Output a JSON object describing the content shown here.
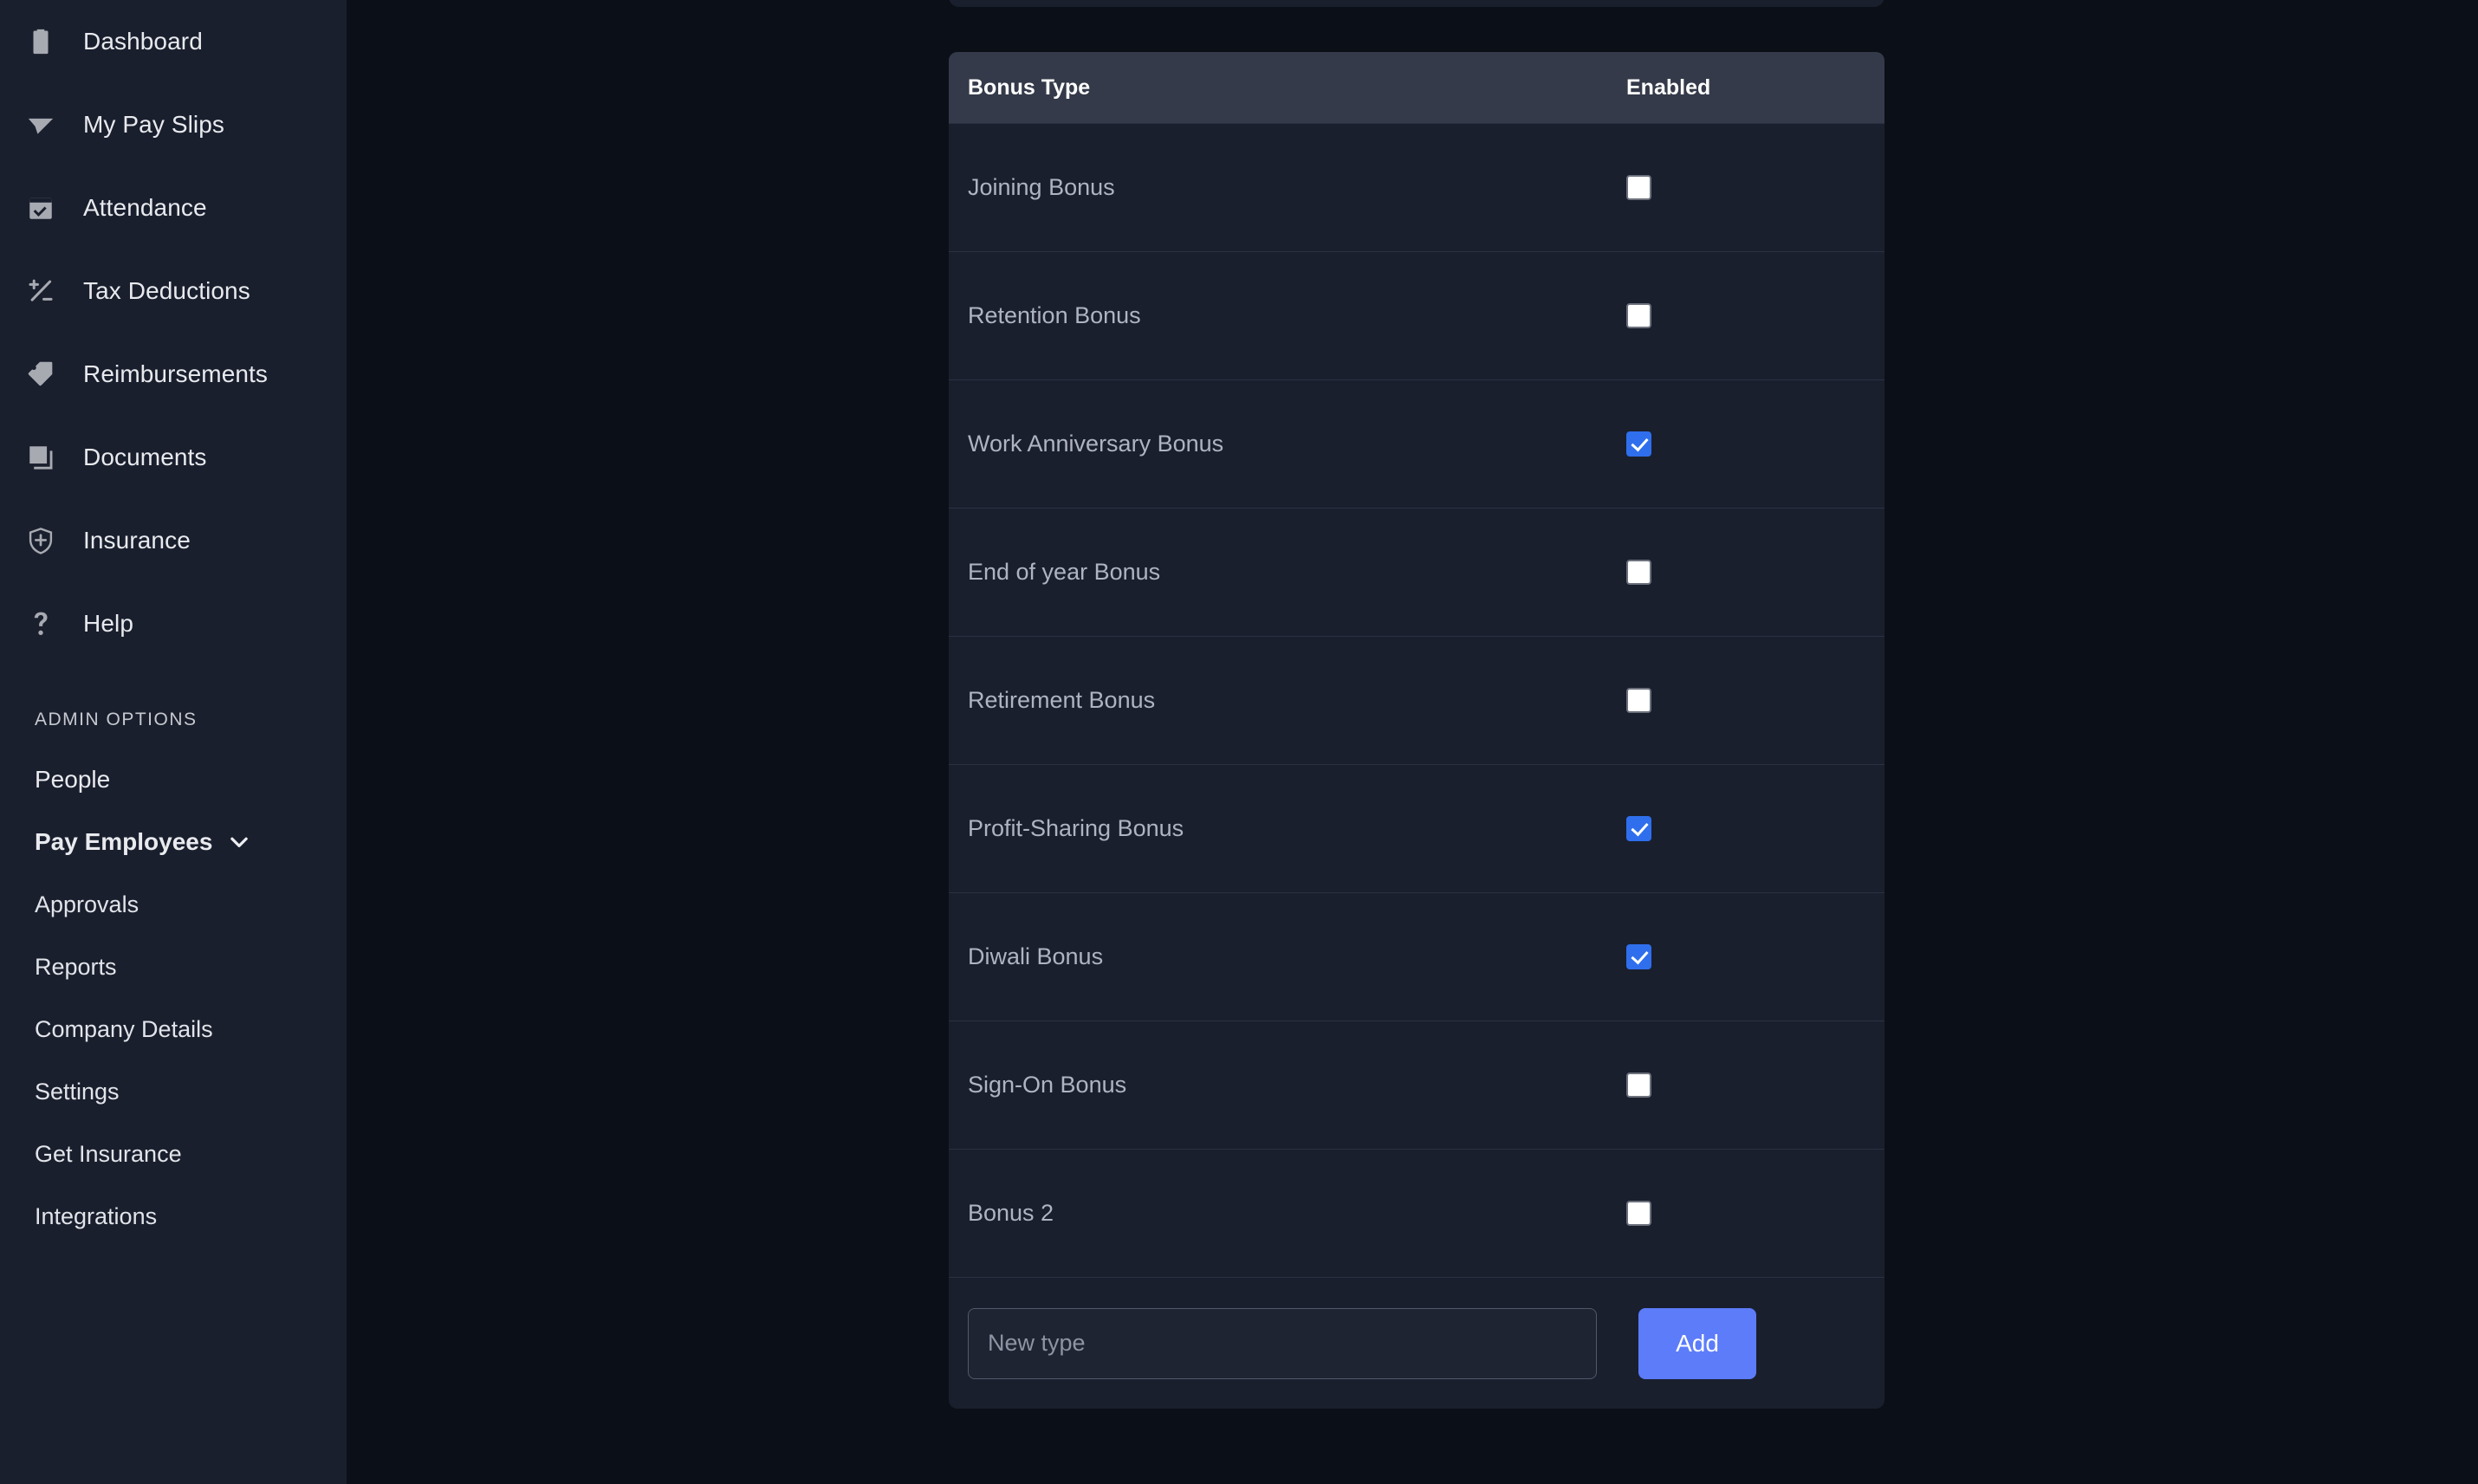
{
  "sidebar": {
    "primary_items": [
      {
        "label": "Dashboard",
        "icon": "clipboard-icon"
      },
      {
        "label": "My Pay Slips",
        "icon": "paper-plane-icon"
      },
      {
        "label": "Attendance",
        "icon": "calendar-check-icon"
      },
      {
        "label": "Tax Deductions",
        "icon": "plus-minus-icon"
      },
      {
        "label": "Reimbursements",
        "icon": "tag-icon"
      },
      {
        "label": "Documents",
        "icon": "documents-icon"
      },
      {
        "label": "Insurance",
        "icon": "shield-plus-icon"
      },
      {
        "label": "Help",
        "icon": "question-mark-icon"
      }
    ],
    "admin_heading": "ADMIN OPTIONS",
    "admin_items": [
      {
        "label": "People",
        "type": "link"
      },
      {
        "label": "Pay Employees",
        "type": "expandable",
        "icon": "chevron-down-icon",
        "expanded": true
      }
    ],
    "admin_sub_items": [
      {
        "label": "Approvals"
      },
      {
        "label": "Reports"
      },
      {
        "label": "Company Details"
      },
      {
        "label": "Settings"
      },
      {
        "label": "Get Insurance"
      },
      {
        "label": "Integrations"
      }
    ]
  },
  "bonus_panel": {
    "columns": [
      "Bonus Type",
      "Enabled"
    ],
    "rows": [
      {
        "name": "Joining Bonus",
        "enabled": false
      },
      {
        "name": "Retention Bonus",
        "enabled": false
      },
      {
        "name": "Work Anniversary Bonus",
        "enabled": true
      },
      {
        "name": "End of year Bonus",
        "enabled": false
      },
      {
        "name": "Retirement Bonus",
        "enabled": false
      },
      {
        "name": "Profit-Sharing Bonus",
        "enabled": true
      },
      {
        "name": "Diwali Bonus",
        "enabled": true
      },
      {
        "name": "Sign-On Bonus",
        "enabled": false
      },
      {
        "name": "Bonus 2",
        "enabled": false
      }
    ],
    "new_type_placeholder": "New type",
    "new_type_value": "",
    "add_label": "Add"
  },
  "colors": {
    "page_background": "#0b0f17",
    "sidebar_background": "#1a1f2e",
    "card_background": "#1a1f2e",
    "table_header_background": "#343a49",
    "row_divider": "#2b3142",
    "accent_button": "#5c7cfa",
    "checkbox_checked": "#2f6fed",
    "label_text": "#aeb4c2",
    "heading_text": "#ffffff"
  }
}
